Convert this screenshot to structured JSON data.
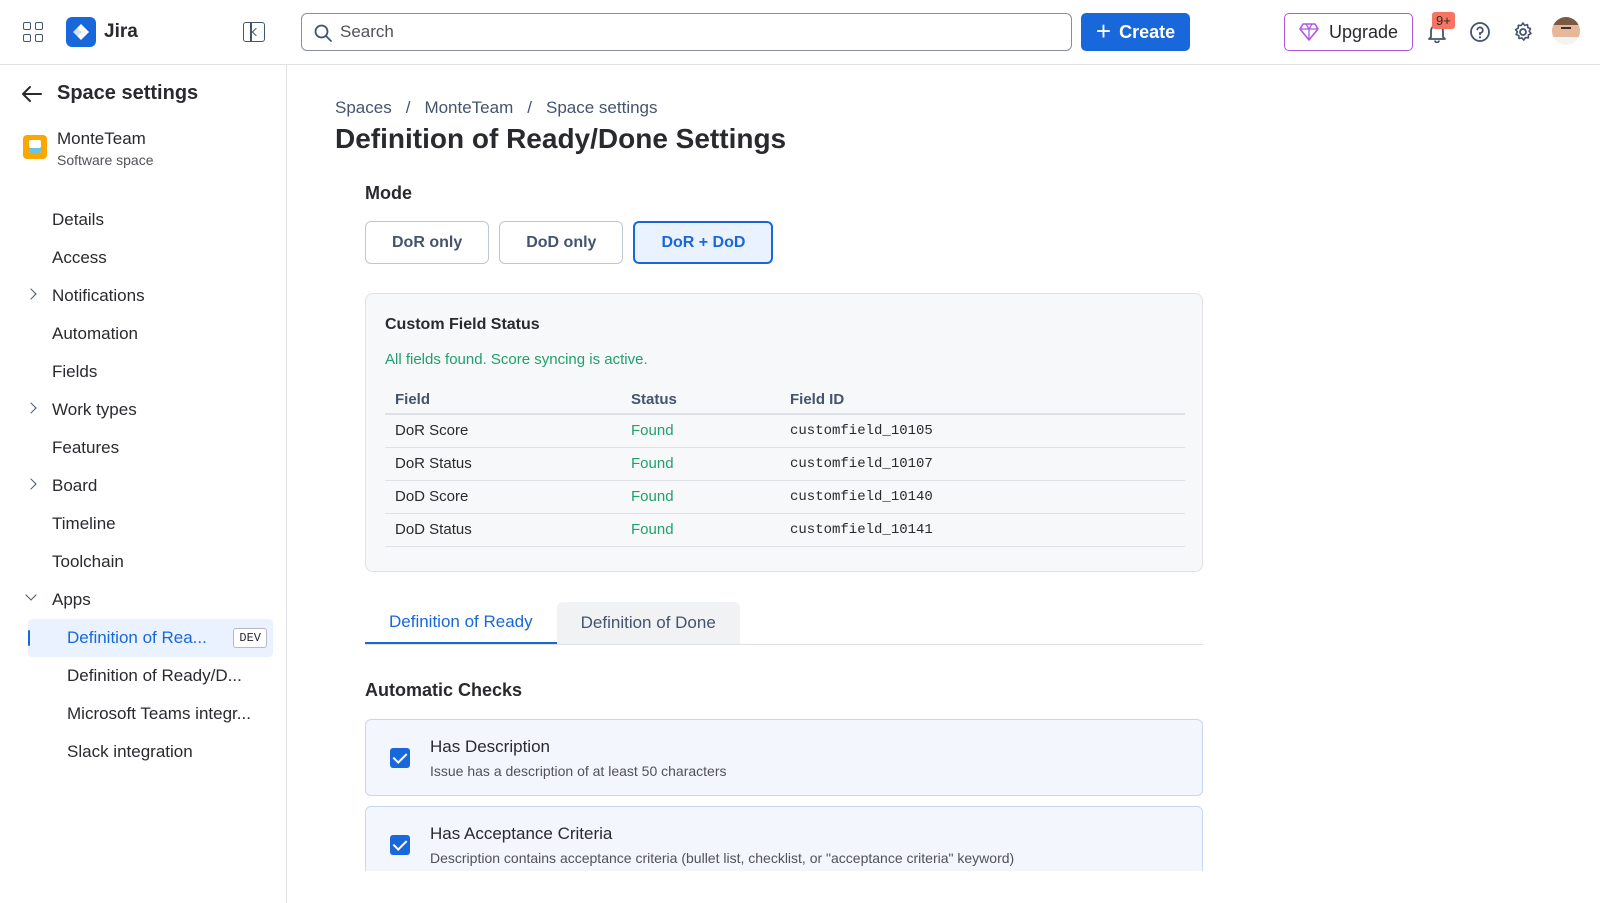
{
  "topbar": {
    "app_name": "Jira",
    "search_placeholder": "Search",
    "create_label": "Create",
    "upgrade_label": "Upgrade",
    "notification_count": "9+"
  },
  "sidebar": {
    "title": "Space settings",
    "space_name": "MonteTeam",
    "space_type": "Software space",
    "items": [
      {
        "label": "Details"
      },
      {
        "label": "Access"
      },
      {
        "label": "Notifications"
      },
      {
        "label": "Automation"
      },
      {
        "label": "Fields"
      },
      {
        "label": "Work types"
      },
      {
        "label": "Features"
      },
      {
        "label": "Board"
      },
      {
        "label": "Timeline"
      },
      {
        "label": "Toolchain"
      },
      {
        "label": "Apps"
      }
    ],
    "apps": [
      {
        "label": "Definition of Rea...",
        "badge": "DEV"
      },
      {
        "label": "Definition of Ready/D..."
      },
      {
        "label": "Microsoft Teams integr..."
      },
      {
        "label": "Slack integration"
      }
    ]
  },
  "breadcrumb": [
    "Spaces",
    "/",
    "MonteTeam",
    "/",
    "Space settings"
  ],
  "page_title": "Definition of Ready/Done Settings",
  "mode": {
    "label": "Mode",
    "options": [
      "DoR only",
      "DoD only",
      "DoR + DoD"
    ],
    "selected": "DoR + DoD"
  },
  "custom_field_status": {
    "title": "Custom Field Status",
    "message": "All fields found. Score syncing is active.",
    "columns": [
      "Field",
      "Status",
      "Field ID"
    ],
    "rows": [
      [
        "DoR Score",
        "Found",
        "customfield_10105"
      ],
      [
        "DoR Status",
        "Found",
        "customfield_10107"
      ],
      [
        "DoD Score",
        "Found",
        "customfield_10140"
      ],
      [
        "DoD Status",
        "Found",
        "customfield_10141"
      ]
    ]
  },
  "tabs": [
    "Definition of Ready",
    "Definition of Done"
  ],
  "automatic_checks": {
    "title": "Automatic Checks",
    "items": [
      {
        "title": "Has Description",
        "desc": "Issue has a description of at least 50 characters",
        "checked": true
      },
      {
        "title": "Has Acceptance Criteria",
        "desc": "Description contains acceptance criteria (bullet list, checklist, or \"acceptance criteria\" keyword)",
        "checked": true
      }
    ]
  },
  "colors": {
    "brand_blue": "#1868db",
    "success_green": "#22a06b",
    "upgrade_purple": "#af59e1"
  }
}
